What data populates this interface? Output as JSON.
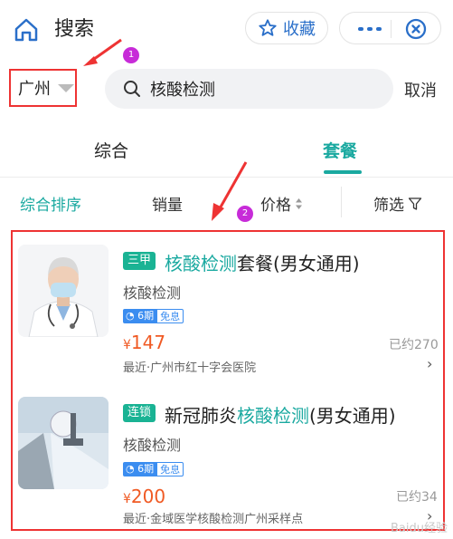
{
  "header": {
    "title": "搜索",
    "favorite_label": "收藏"
  },
  "search": {
    "city": "广州",
    "query": "核酸检测",
    "cancel_label": "取消"
  },
  "annotations": {
    "marker1": "1",
    "marker2": "2"
  },
  "tabs": [
    {
      "label": "综合"
    },
    {
      "label": "套餐",
      "active": true
    }
  ],
  "sort": {
    "comprehensive": "综合排序",
    "sales": "销量",
    "price": "价格",
    "filter": "筛选"
  },
  "results": [
    {
      "tag": "三甲",
      "title_highlight": "核酸检测",
      "title_rest": "套餐(男女通用)",
      "subtitle": "核酸检测",
      "installment": "6期",
      "interest_free": "免息",
      "currency": "¥",
      "price": "147",
      "sold": "已约270",
      "hospital": "最近·广州市红十字会医院"
    },
    {
      "tag": "连锁",
      "title_prefix": "新冠肺炎",
      "title_highlight": "核酸检测",
      "title_rest": "(男女通用)",
      "subtitle": "核酸检测",
      "installment": "6期",
      "interest_free": "免息",
      "currency": "¥",
      "price": "200",
      "sold": "已约34",
      "hospital": "最近·金域医学核酸检测广州采样点"
    }
  ],
  "watermark": "Baidu经验",
  "colors": {
    "accent": "#1aa9a0",
    "price": "#f05a24",
    "annotation": "#e33333",
    "marker": "#c72bd8"
  }
}
